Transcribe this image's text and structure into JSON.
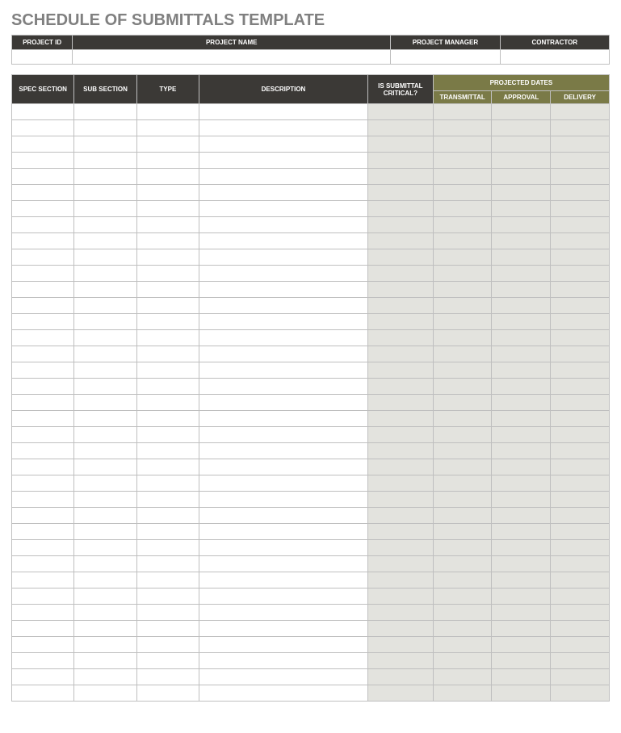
{
  "title": "SCHEDULE OF SUBMITTALS TEMPLATE",
  "project_header": {
    "project_id_label": "PROJECT ID",
    "project_name_label": "PROJECT NAME",
    "project_manager_label": "PROJECT MANAGER",
    "contractor_label": "CONTRACTOR",
    "project_id": "",
    "project_name": "",
    "project_manager": "",
    "contractor": ""
  },
  "schedule_header": {
    "spec_section": "SPEC SECTION",
    "sub_section": "SUB SECTION",
    "type": "TYPE",
    "description": "DESCRIPTION",
    "is_critical": "IS SUBMITTAL CRITICAL?",
    "projected_dates": "PROJECTED DATES",
    "transmittal": "TRANSMITTAL",
    "approval": "APPROVAL",
    "delivery": "DELIVERY"
  },
  "rows": [
    {
      "spec_section": "",
      "sub_section": "",
      "type": "",
      "description": "",
      "is_critical": "",
      "transmittal": "",
      "approval": "",
      "delivery": ""
    },
    {
      "spec_section": "",
      "sub_section": "",
      "type": "",
      "description": "",
      "is_critical": "",
      "transmittal": "",
      "approval": "",
      "delivery": ""
    },
    {
      "spec_section": "",
      "sub_section": "",
      "type": "",
      "description": "",
      "is_critical": "",
      "transmittal": "",
      "approval": "",
      "delivery": ""
    },
    {
      "spec_section": "",
      "sub_section": "",
      "type": "",
      "description": "",
      "is_critical": "",
      "transmittal": "",
      "approval": "",
      "delivery": ""
    },
    {
      "spec_section": "",
      "sub_section": "",
      "type": "",
      "description": "",
      "is_critical": "",
      "transmittal": "",
      "approval": "",
      "delivery": ""
    },
    {
      "spec_section": "",
      "sub_section": "",
      "type": "",
      "description": "",
      "is_critical": "",
      "transmittal": "",
      "approval": "",
      "delivery": ""
    },
    {
      "spec_section": "",
      "sub_section": "",
      "type": "",
      "description": "",
      "is_critical": "",
      "transmittal": "",
      "approval": "",
      "delivery": ""
    },
    {
      "spec_section": "",
      "sub_section": "",
      "type": "",
      "description": "",
      "is_critical": "",
      "transmittal": "",
      "approval": "",
      "delivery": ""
    },
    {
      "spec_section": "",
      "sub_section": "",
      "type": "",
      "description": "",
      "is_critical": "",
      "transmittal": "",
      "approval": "",
      "delivery": ""
    },
    {
      "spec_section": "",
      "sub_section": "",
      "type": "",
      "description": "",
      "is_critical": "",
      "transmittal": "",
      "approval": "",
      "delivery": ""
    },
    {
      "spec_section": "",
      "sub_section": "",
      "type": "",
      "description": "",
      "is_critical": "",
      "transmittal": "",
      "approval": "",
      "delivery": ""
    },
    {
      "spec_section": "",
      "sub_section": "",
      "type": "",
      "description": "",
      "is_critical": "",
      "transmittal": "",
      "approval": "",
      "delivery": ""
    },
    {
      "spec_section": "",
      "sub_section": "",
      "type": "",
      "description": "",
      "is_critical": "",
      "transmittal": "",
      "approval": "",
      "delivery": ""
    },
    {
      "spec_section": "",
      "sub_section": "",
      "type": "",
      "description": "",
      "is_critical": "",
      "transmittal": "",
      "approval": "",
      "delivery": ""
    },
    {
      "spec_section": "",
      "sub_section": "",
      "type": "",
      "description": "",
      "is_critical": "",
      "transmittal": "",
      "approval": "",
      "delivery": ""
    },
    {
      "spec_section": "",
      "sub_section": "",
      "type": "",
      "description": "",
      "is_critical": "",
      "transmittal": "",
      "approval": "",
      "delivery": ""
    },
    {
      "spec_section": "",
      "sub_section": "",
      "type": "",
      "description": "",
      "is_critical": "",
      "transmittal": "",
      "approval": "",
      "delivery": ""
    },
    {
      "spec_section": "",
      "sub_section": "",
      "type": "",
      "description": "",
      "is_critical": "",
      "transmittal": "",
      "approval": "",
      "delivery": ""
    },
    {
      "spec_section": "",
      "sub_section": "",
      "type": "",
      "description": "",
      "is_critical": "",
      "transmittal": "",
      "approval": "",
      "delivery": ""
    },
    {
      "spec_section": "",
      "sub_section": "",
      "type": "",
      "description": "",
      "is_critical": "",
      "transmittal": "",
      "approval": "",
      "delivery": ""
    },
    {
      "spec_section": "",
      "sub_section": "",
      "type": "",
      "description": "",
      "is_critical": "",
      "transmittal": "",
      "approval": "",
      "delivery": ""
    },
    {
      "spec_section": "",
      "sub_section": "",
      "type": "",
      "description": "",
      "is_critical": "",
      "transmittal": "",
      "approval": "",
      "delivery": ""
    },
    {
      "spec_section": "",
      "sub_section": "",
      "type": "",
      "description": "",
      "is_critical": "",
      "transmittal": "",
      "approval": "",
      "delivery": ""
    },
    {
      "spec_section": "",
      "sub_section": "",
      "type": "",
      "description": "",
      "is_critical": "",
      "transmittal": "",
      "approval": "",
      "delivery": ""
    },
    {
      "spec_section": "",
      "sub_section": "",
      "type": "",
      "description": "",
      "is_critical": "",
      "transmittal": "",
      "approval": "",
      "delivery": ""
    },
    {
      "spec_section": "",
      "sub_section": "",
      "type": "",
      "description": "",
      "is_critical": "",
      "transmittal": "",
      "approval": "",
      "delivery": ""
    },
    {
      "spec_section": "",
      "sub_section": "",
      "type": "",
      "description": "",
      "is_critical": "",
      "transmittal": "",
      "approval": "",
      "delivery": ""
    },
    {
      "spec_section": "",
      "sub_section": "",
      "type": "",
      "description": "",
      "is_critical": "",
      "transmittal": "",
      "approval": "",
      "delivery": ""
    },
    {
      "spec_section": "",
      "sub_section": "",
      "type": "",
      "description": "",
      "is_critical": "",
      "transmittal": "",
      "approval": "",
      "delivery": ""
    },
    {
      "spec_section": "",
      "sub_section": "",
      "type": "",
      "description": "",
      "is_critical": "",
      "transmittal": "",
      "approval": "",
      "delivery": ""
    },
    {
      "spec_section": "",
      "sub_section": "",
      "type": "",
      "description": "",
      "is_critical": "",
      "transmittal": "",
      "approval": "",
      "delivery": ""
    },
    {
      "spec_section": "",
      "sub_section": "",
      "type": "",
      "description": "",
      "is_critical": "",
      "transmittal": "",
      "approval": "",
      "delivery": ""
    },
    {
      "spec_section": "",
      "sub_section": "",
      "type": "",
      "description": "",
      "is_critical": "",
      "transmittal": "",
      "approval": "",
      "delivery": ""
    },
    {
      "spec_section": "",
      "sub_section": "",
      "type": "",
      "description": "",
      "is_critical": "",
      "transmittal": "",
      "approval": "",
      "delivery": ""
    },
    {
      "spec_section": "",
      "sub_section": "",
      "type": "",
      "description": "",
      "is_critical": "",
      "transmittal": "",
      "approval": "",
      "delivery": ""
    },
    {
      "spec_section": "",
      "sub_section": "",
      "type": "",
      "description": "",
      "is_critical": "",
      "transmittal": "",
      "approval": "",
      "delivery": ""
    },
    {
      "spec_section": "",
      "sub_section": "",
      "type": "",
      "description": "",
      "is_critical": "",
      "transmittal": "",
      "approval": "",
      "delivery": ""
    }
  ]
}
